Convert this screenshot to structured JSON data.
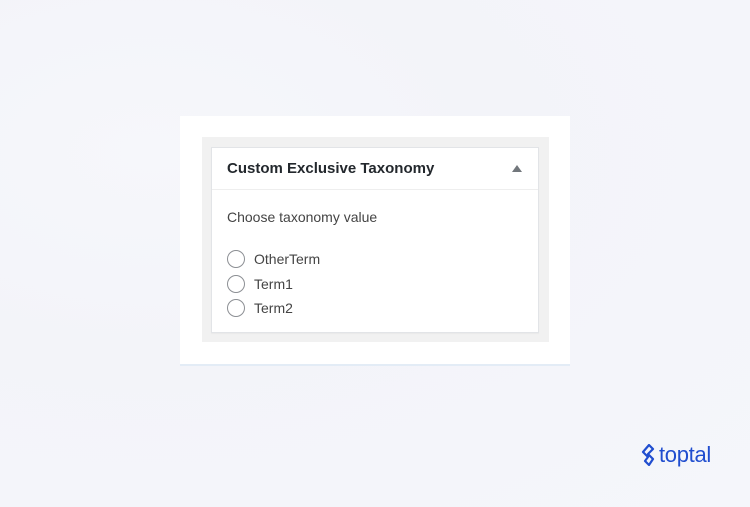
{
  "metabox": {
    "title": "Custom Exclusive Taxonomy",
    "toggle_icon": "triangle-up-icon",
    "prompt": "Choose taxonomy value",
    "options": [
      {
        "label": "OtherTerm",
        "checked": false
      },
      {
        "label": "Term1",
        "checked": false
      },
      {
        "label": "Term2",
        "checked": false
      }
    ]
  },
  "brand": {
    "name": "toptal",
    "color": "#204ecf"
  }
}
